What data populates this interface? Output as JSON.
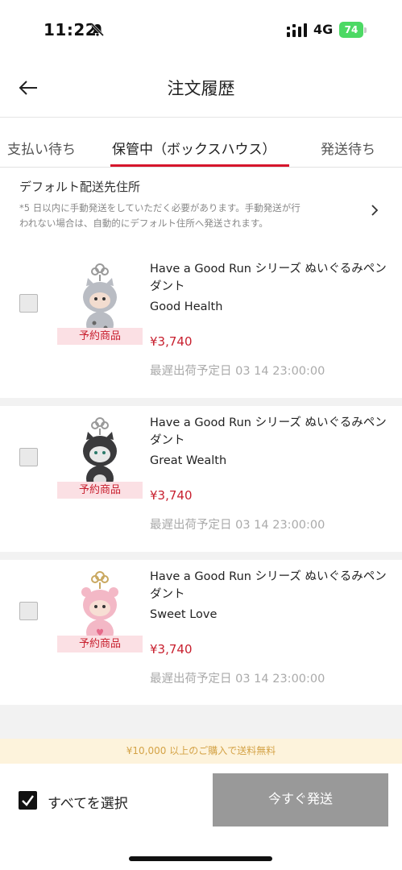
{
  "status_bar": {
    "time": "11:22",
    "network": "4G",
    "battery": "74"
  },
  "header": {
    "title": "注文履歴"
  },
  "tabs": [
    {
      "label": "支払い待ち"
    },
    {
      "label": "保管中（ボックスハウス）"
    },
    {
      "label": "発送待ち"
    }
  ],
  "address": {
    "title": "デフォルト配送先住所",
    "note": "*5 日以内に手動発送をしていただく必要があります。手動発送が行われない場合は、自動的にデフォルト住所へ発送されます。"
  },
  "items": [
    {
      "name": "Have a Good Run シリーズ ぬいぐるみペンダント",
      "variant": "Good Health",
      "tag": "予約商品",
      "price": "¥3,740",
      "ship": "最遅出荷予定日 03 14 23:00:00",
      "figure_color": "#b9bcc3"
    },
    {
      "name": "Have a Good Run シリーズ ぬいぐるみペンダント",
      "variant": "Great Wealth",
      "tag": "予約商品",
      "price": "¥3,740",
      "ship": "最遅出荷予定日 03 14 23:00:00",
      "figure_color": "#3a3a3c"
    },
    {
      "name": "Have a Good Run シリーズ ぬいぐるみペンダント",
      "variant": "Sweet Love",
      "tag": "予約商品",
      "price": "¥3,740",
      "ship": "最遅出荷予定日 03 14 23:00:00",
      "figure_color": "#f3b8c6"
    }
  ],
  "promo": {
    "free_shipping": "¥10,000 以上のご購入で送料無料"
  },
  "footer": {
    "select_all": "すべてを選択",
    "ship_now": "今すぐ発送"
  },
  "colors": {
    "accent": "#d6162c",
    "price": "#c8202f",
    "button": "#999999"
  }
}
